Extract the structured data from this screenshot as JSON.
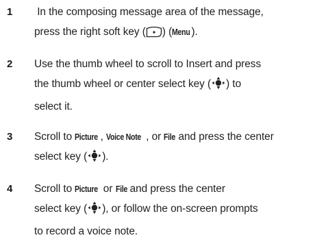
{
  "steps": [
    {
      "number": "1",
      "line1": "In the composing message area of the message,",
      "line2_a": "press the right soft key (",
      "line2_b": ") (",
      "line2_menu": "Menu",
      "line2_c": ")."
    },
    {
      "number": "2",
      "line1": "Use the thumb wheel to scroll to Insert and press",
      "line2": "the thumb wheel or center select key (",
      "line2_end": ") to",
      "line3": "select it."
    },
    {
      "number": "3",
      "line1_a": "Scroll to ",
      "picture": "Picture",
      "sep1": ", ",
      "voice_note": "Voice Note",
      "sep2": ", or ",
      "file": "File",
      "line1_b": " and press the center",
      "line2_a": "select key (",
      "line2_b": ")."
    },
    {
      "number": "4",
      "line1_a": "Scroll to ",
      "picture": "Picture",
      "or": " or ",
      "file": "File",
      "line1_b": " and press the center",
      "line2_a": "select key (",
      "line2_b": "), or follow the on-screen prompts",
      "line3": "to record a voice note."
    }
  ],
  "icons": {
    "soft_key": "right-soft-key-icon",
    "nav_key": "center-select-key-icon"
  }
}
